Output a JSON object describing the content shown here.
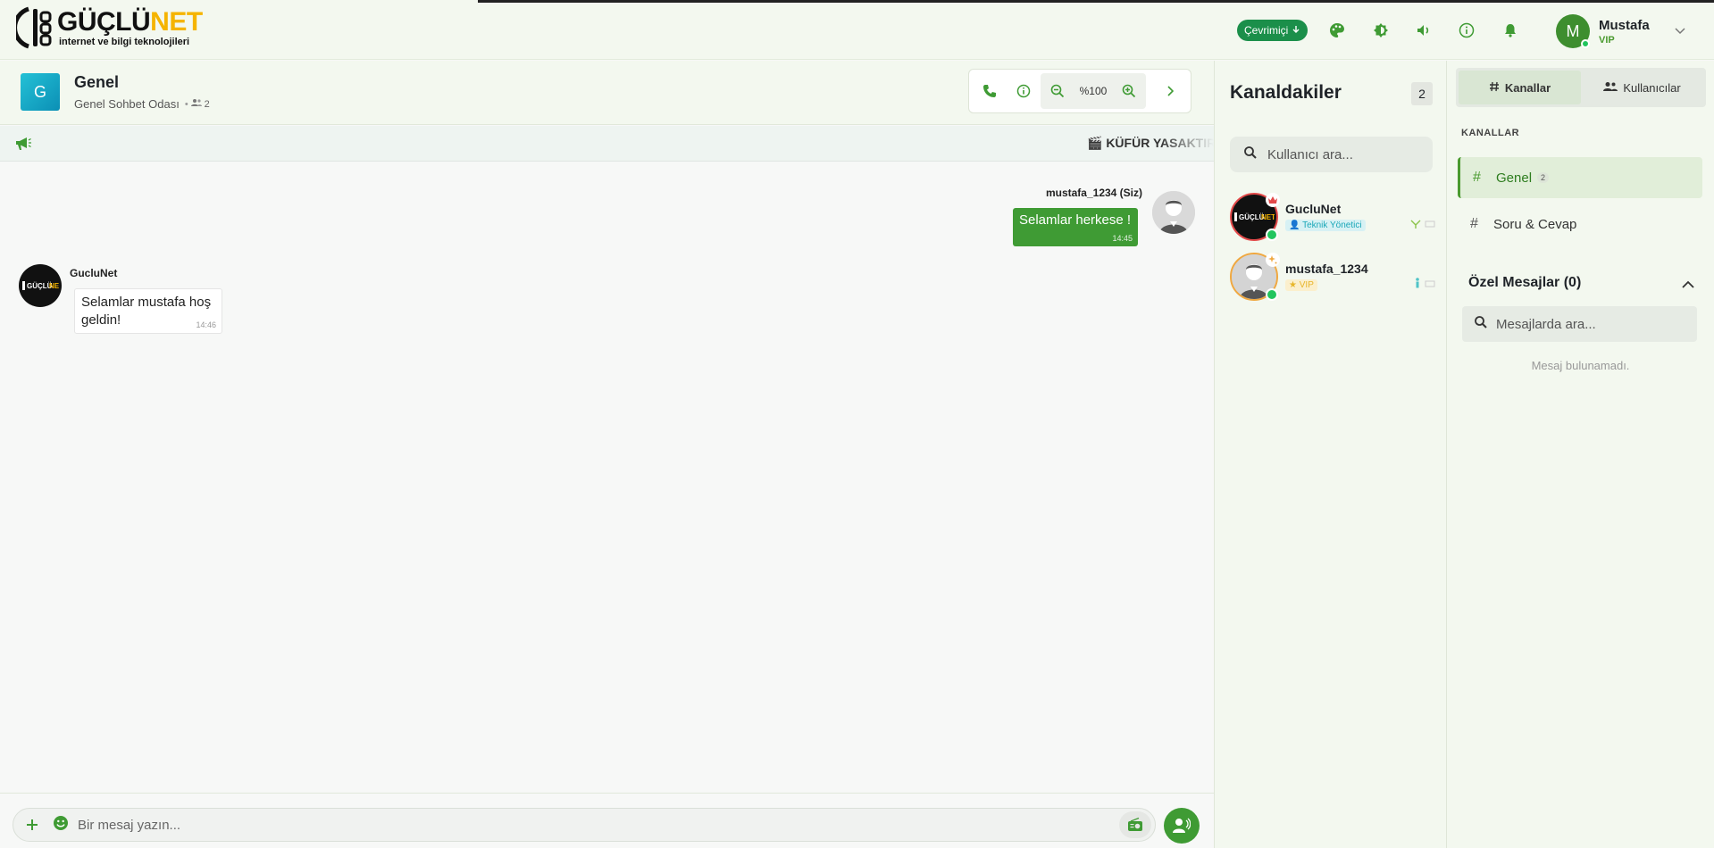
{
  "colors": {
    "brand_green": "#3f9b34",
    "status_green": "#1b8f4a",
    "accent_yellow": "#f5b400",
    "admin_red": "#e34a4a"
  },
  "logo": {
    "word_main": "GÜÇLÜ",
    "word_accent": "NET",
    "tagline": "internet ve bilgi teknolojileri"
  },
  "header": {
    "status_label": "Çevrimiçi",
    "icons": [
      "palette-icon",
      "contrast-icon",
      "volume-icon",
      "info-icon",
      "bell-icon"
    ],
    "user": {
      "initial": "M",
      "name": "Mustafa",
      "role": "VIP"
    }
  },
  "channel": {
    "icon_letter": "G",
    "title": "Genel",
    "subtitle": "Genel Sohbet Odası",
    "member_count": "2",
    "zoom": "%100"
  },
  "announcement": {
    "text": "🎬 KÜFÜR YASAKTIR"
  },
  "messages": [
    {
      "sender": "mustafa_1234 (Siz)",
      "text": "Selamlar herkese !",
      "time": "14:45",
      "mine": true
    },
    {
      "sender": "GucluNet",
      "text": "Selamlar mustafa hoş geldin!",
      "time": "14:46",
      "mine": false
    }
  ],
  "composer": {
    "placeholder": "Bir mesaj yazın..."
  },
  "members_panel": {
    "title": "Kanaldakiler",
    "count": "2",
    "search_placeholder": "Kullanıcı ara...",
    "members": [
      {
        "name": "GucluNet",
        "role": "Teknik Yönetici",
        "badge": "crown-icon"
      },
      {
        "name": "mustafa_1234",
        "role": "VIP",
        "badge": "sparkle-icon"
      }
    ]
  },
  "right_panel": {
    "tabs": [
      {
        "label": "Kanallar",
        "icon": "hash-icon"
      },
      {
        "label": "Kullanıcılar",
        "icon": "users-icon"
      }
    ],
    "section_label": "KANALLAR",
    "channels": [
      {
        "name": "Genel",
        "count": "2"
      },
      {
        "name": "Soru & Cevap"
      }
    ],
    "pm_title": "Özel Mesajlar (0)",
    "pm_search_placeholder": "Mesajlarda ara...",
    "pm_empty": "Mesaj bulunamadı."
  }
}
